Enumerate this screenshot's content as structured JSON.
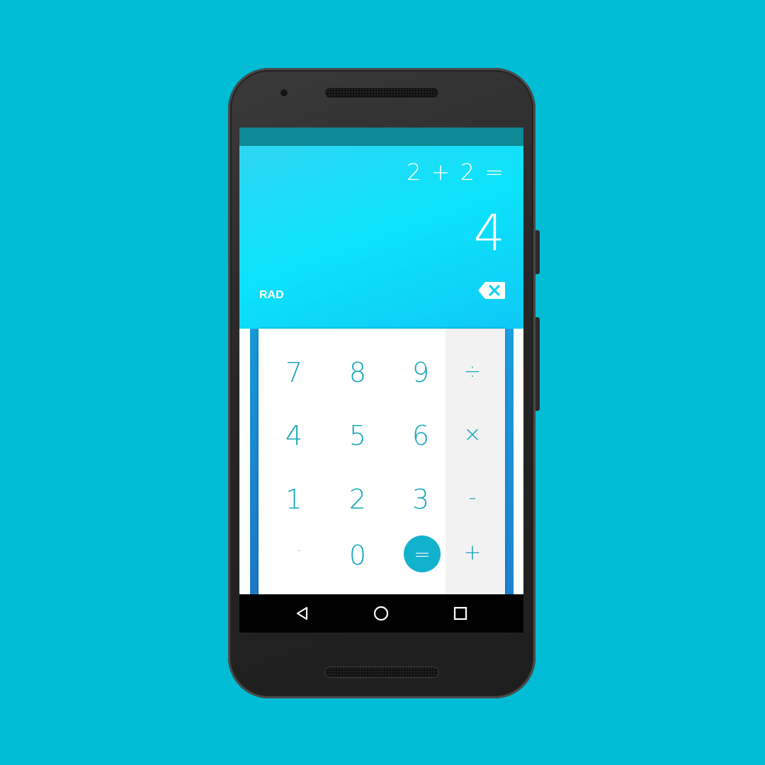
{
  "display": {
    "formula": "2 + 2 =",
    "result": "4",
    "mode_label": "RAD",
    "backspace_icon": "backspace-icon"
  },
  "keypad": {
    "digits": [
      "7",
      "8",
      "9",
      "4",
      "5",
      "6",
      "1",
      "2",
      "3",
      "·",
      "0"
    ],
    "operators": {
      "divide": "÷",
      "multiply": "×",
      "minus": "-",
      "plus": "+",
      "equals": "="
    }
  },
  "navigation": {
    "back_icon": "back-triangle-icon",
    "home_icon": "home-circle-icon",
    "recents_icon": "recents-square-icon"
  },
  "colors": {
    "background": "#00bcd4",
    "display_gradient": "#0ce3fb",
    "key_text": "#17a5bd",
    "equals_button": "#12b1cd",
    "status_bar": "#0d8a96"
  }
}
